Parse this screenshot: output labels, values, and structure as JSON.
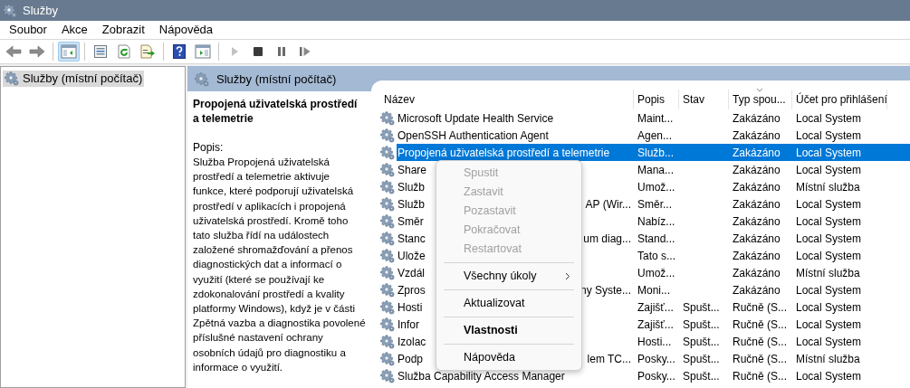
{
  "window": {
    "title": "Služby"
  },
  "menu_bar": [
    "Soubor",
    "Akce",
    "Zobrazit",
    "Nápověda"
  ],
  "toolbar": [
    {
      "kind": "back",
      "selected": false,
      "disabled": false
    },
    {
      "kind": "forward",
      "selected": false,
      "disabled": false
    },
    {
      "kind": "sep"
    },
    {
      "kind": "tree",
      "selected": true,
      "disabled": false
    },
    {
      "kind": "sep"
    },
    {
      "kind": "properties",
      "selected": false,
      "disabled": false
    },
    {
      "kind": "refresh",
      "selected": false,
      "disabled": false
    },
    {
      "kind": "export",
      "selected": false,
      "disabled": false
    },
    {
      "kind": "sep"
    },
    {
      "kind": "help",
      "selected": false,
      "disabled": false
    },
    {
      "kind": "pane",
      "selected": false,
      "disabled": false
    },
    {
      "kind": "sep"
    },
    {
      "kind": "play",
      "selected": false,
      "disabled": true
    },
    {
      "kind": "stop",
      "selected": false,
      "disabled": false
    },
    {
      "kind": "pause",
      "selected": false,
      "disabled": false
    },
    {
      "kind": "resume",
      "selected": false,
      "disabled": false
    }
  ],
  "tree": [
    {
      "label": "Služby (místní počítač)",
      "selected": true
    }
  ],
  "pane_title": "Služby (místní počítač)",
  "description": {
    "title": "Propojená uživatelská prostředí a telemetrie",
    "label": "Popis:",
    "text": "Služba Propojená uživatelská prostředí a telemetrie aktivuje funkce, které podporují uživatelská prostředí v aplikacích i propojená uživatelská prostředí. Kromě toho tato služba řídí na událostech založené shromažďování a přenos diagnostických dat a informací o využití (které se používají ke zdokonalování prostředí a kvality platformy Windows), když je v části Zpětná vazba a diagnostika povolené příslušné nastavení ochrany osobních údajů pro diagnostiku a informace o využití."
  },
  "table": {
    "columns": [
      {
        "label": "Název",
        "sorted": false
      },
      {
        "label": "Popis",
        "sorted": false
      },
      {
        "label": "Stav",
        "sorted": false
      },
      {
        "label": "Typ spou...",
        "sorted": true
      },
      {
        "label": "Účet pro přihlášení",
        "sorted": false
      }
    ],
    "rows": [
      {
        "name": "Microsoft Update Health Service",
        "popis": "Maint...",
        "stav": "",
        "typ": "Zakázáno",
        "ucet": "Local System",
        "selected": false
      },
      {
        "name": "OpenSSH Authentication Agent",
        "popis": "Agen...",
        "stav": "",
        "typ": "Zakázáno",
        "ucet": "Local System",
        "selected": false
      },
      {
        "name": "Propojená uživatelská prostředí a telemetrie",
        "popis": "Služb...",
        "stav": "",
        "typ": "Zakázáno",
        "ucet": "Local System",
        "selected": true
      },
      {
        "name": "Share",
        "popis": "Mana...",
        "stav": "",
        "typ": "Zakázáno",
        "ucet": "Local System",
        "selected": false
      },
      {
        "name": "Služb",
        "popis": "Umož...",
        "stav": "",
        "typ": "Zakázáno",
        "ucet": "Místní služba",
        "selected": false
      },
      {
        "name": "Služb",
        "name_tail": "AP (Wir...",
        "popis": "Směr...",
        "stav": "",
        "typ": "Zakázáno",
        "ucet": "Local System",
        "selected": false
      },
      {
        "name": "Směr",
        "popis": "Nabíz...",
        "stav": "",
        "typ": "Zakázáno",
        "ucet": "Local System",
        "selected": false
      },
      {
        "name": "Stanc",
        "name_tail": "um diag...",
        "popis": "Stand...",
        "stav": "",
        "typ": "Zakázáno",
        "ucet": "Local System",
        "selected": false
      },
      {
        "name": "Ulože",
        "popis": "Tato s...",
        "stav": "",
        "typ": "Zakázáno",
        "ucet": "Local System",
        "selected": false
      },
      {
        "name": "Vzdál",
        "popis": "Umož...",
        "stav": "",
        "typ": "Zakázáno",
        "ucet": "Místní služba",
        "selected": false
      },
      {
        "name": "Zpros",
        "name_tail": "ny Syste...",
        "popis": "Moni...",
        "stav": "",
        "typ": "Zakázáno",
        "ucet": "Local System",
        "selected": false
      },
      {
        "name": "Hosti",
        "popis": "Zajišť...",
        "stav": "Spušt...",
        "typ": "Ručně (S...",
        "ucet": "Local System",
        "selected": false
      },
      {
        "name": "Infor",
        "popis": "Zajišť...",
        "stav": "Spušt...",
        "typ": "Ručně (S...",
        "ucet": "Local System",
        "selected": false
      },
      {
        "name": "Izolac",
        "popis": "Hosti...",
        "stav": "Spušt...",
        "typ": "Ručně (S...",
        "ucet": "Local System",
        "selected": false
      },
      {
        "name": "Podp",
        "name_tail": "lem TC...",
        "popis": "Posky...",
        "stav": "Spušt...",
        "typ": "Ručně (S...",
        "ucet": "Místní služba",
        "selected": false
      },
      {
        "name": "Služba Capability Access Manager",
        "popis": "Posky...",
        "stav": "Spušt...",
        "typ": "Ručně (S...",
        "ucet": "Local System",
        "selected": false
      }
    ]
  },
  "context_menu": [
    {
      "kind": "item",
      "label": "Spustit",
      "disabled": true,
      "default": false,
      "submenu": false
    },
    {
      "kind": "item",
      "label": "Zastavit",
      "disabled": true,
      "default": false,
      "submenu": false
    },
    {
      "kind": "item",
      "label": "Pozastavit",
      "disabled": true,
      "default": false,
      "submenu": false
    },
    {
      "kind": "item",
      "label": "Pokračovat",
      "disabled": true,
      "default": false,
      "submenu": false
    },
    {
      "kind": "item",
      "label": "Restartovat",
      "disabled": true,
      "default": false,
      "submenu": false
    },
    {
      "kind": "separator"
    },
    {
      "kind": "item",
      "label": "Všechny úkoly",
      "disabled": false,
      "default": false,
      "submenu": true
    },
    {
      "kind": "separator"
    },
    {
      "kind": "item",
      "label": "Aktualizovat",
      "disabled": false,
      "default": false,
      "submenu": false
    },
    {
      "kind": "separator"
    },
    {
      "kind": "item",
      "label": "Vlastnosti",
      "disabled": false,
      "default": true,
      "submenu": false
    },
    {
      "kind": "separator"
    },
    {
      "kind": "item",
      "label": "Nápověda",
      "disabled": false,
      "default": false,
      "submenu": false
    }
  ]
}
